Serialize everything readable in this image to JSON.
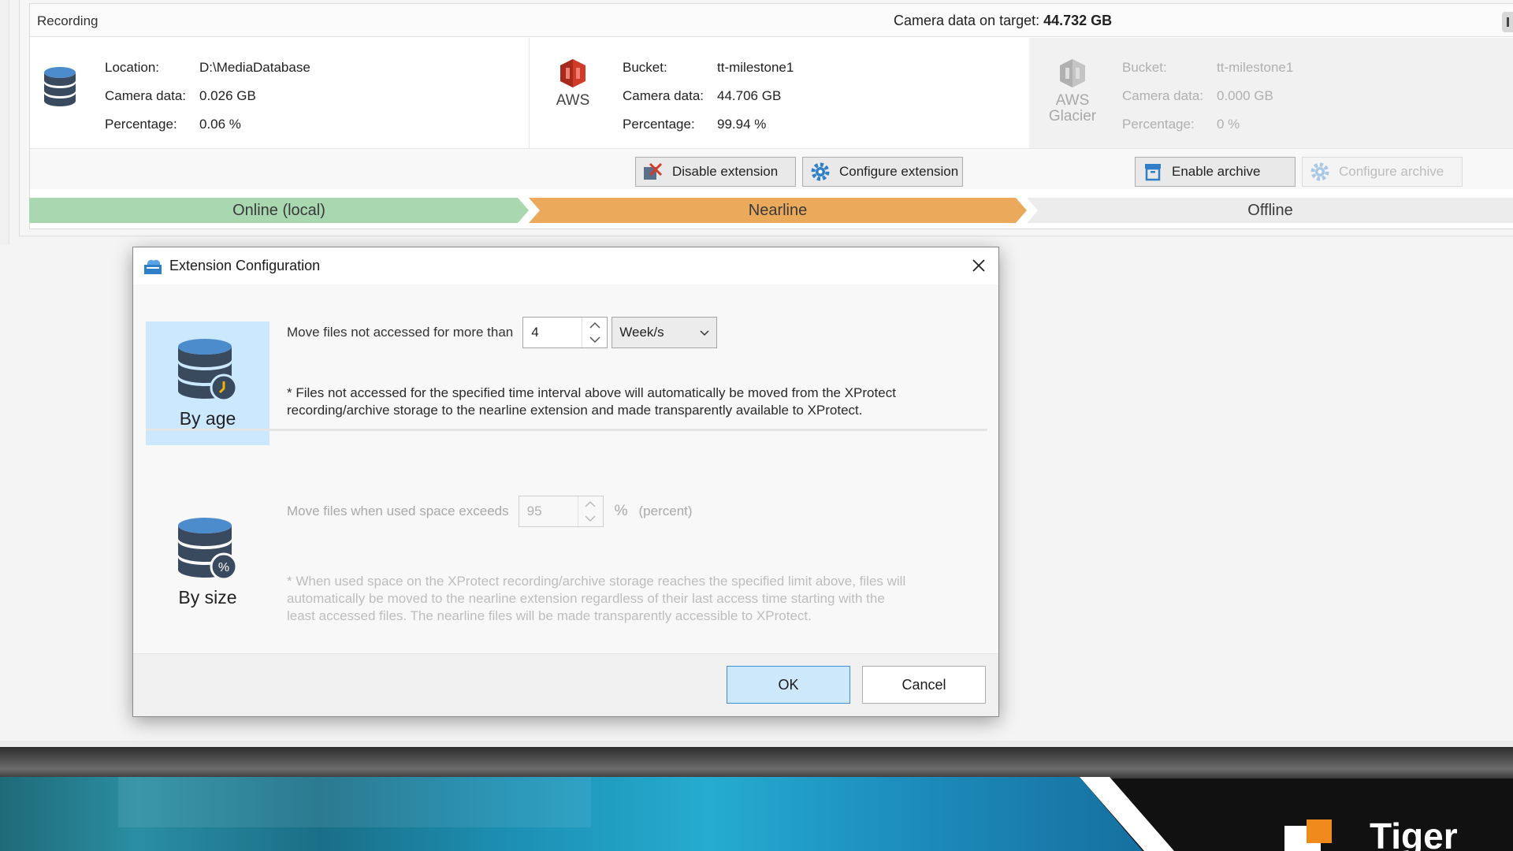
{
  "recording": {
    "title": "Recording",
    "camera_total_label": "Camera data on target:",
    "camera_total_value": "44.732 GB"
  },
  "tiers": {
    "local": {
      "location_label": "Location:",
      "location_value": "D:\\MediaDatabase",
      "camera_data_label": "Camera data:",
      "camera_data_value": "0.026 GB",
      "percentage_label": "Percentage:",
      "percentage_value": "0.06 %"
    },
    "nearline": {
      "provider": "AWS",
      "bucket_label": "Bucket:",
      "bucket_value": "tt-milestone1",
      "camera_data_label": "Camera data:",
      "camera_data_value": "44.706 GB",
      "percentage_label": "Percentage:",
      "percentage_value": "99.94 %"
    },
    "offline": {
      "provider_line1": "AWS",
      "provider_line2": "Glacier",
      "bucket_label": "Bucket:",
      "bucket_value": "tt-milestone1",
      "camera_data_label": "Camera data:",
      "camera_data_value": "0.000 GB",
      "percentage_label": "Percentage:",
      "percentage_value": "0 %"
    }
  },
  "buttons": {
    "disable_extension": "Disable extension",
    "configure_extension": "Configure extension",
    "enable_archive": "Enable archive",
    "configure_archive": "Configure archive"
  },
  "pipeline": {
    "local": "Online (local)",
    "nearline": "Nearline",
    "offline": "Offline"
  },
  "dialog": {
    "title": "Extension Configuration",
    "by_age": {
      "label": "By age",
      "rule_text": "Move files not accessed for more than",
      "value": "4",
      "unit": "Week/s",
      "note_line1": "* Files not accessed for the specified time interval above will automatically be moved from the XProtect",
      "note_line2": "recording/archive storage to the nearline extension and made transparently available to XProtect."
    },
    "by_size": {
      "label": "By size",
      "rule_text": "Move files when used space exceeds",
      "value": "95",
      "percent_sign": "%",
      "percent_word": "(percent)",
      "note_line1": "* When used space on the XProtect recording/archive storage reaches the specified limit above, files will",
      "note_line2": "automatically be moved to the nearline extension regardless of their last access time starting with the",
      "note_line3": "least accessed files. The nearline files will be made transparently accessible to XProtect."
    },
    "ok_label": "OK",
    "cancel_label": "Cancel"
  },
  "banner": {
    "logo_text": "Tiger"
  },
  "colors": {
    "online": "#a8d7b0",
    "nearline": "#eba95c",
    "offline": "#ececec",
    "selected_tile": "#cce8ff",
    "aws_red": "#d13b2a",
    "db_blue": "#3a7fc2",
    "logo_orange": "#f08a1c"
  },
  "icons": {
    "local_storage": "database-icon",
    "nearline": "aws-icon",
    "offline": "aws-glacier-icon",
    "by_age": "database-clock-icon",
    "by_size": "database-percent-icon"
  }
}
